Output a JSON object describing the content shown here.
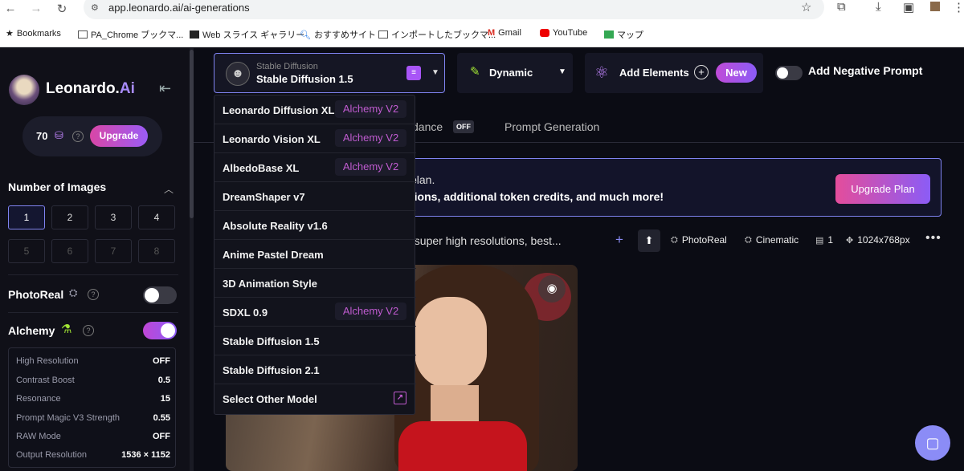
{
  "browser": {
    "url": "app.leonardo.ai/ai-generations",
    "bookmarks": [
      "Bookmarks",
      "PA_Chrome ブックマ...",
      "Web スライス ギャラリー",
      "おすすめサイト",
      "インポートしたブックマ...",
      "Gmail",
      "YouTube",
      "マップ"
    ]
  },
  "sidebar": {
    "brand_main": "Leonardo.",
    "brand_accent": "Ai",
    "tokens": "70",
    "upgrade_label": "Upgrade",
    "num_images_title": "Number of Images",
    "num_buttons": [
      "1",
      "2",
      "3",
      "4",
      "5",
      "6",
      "7",
      "8"
    ],
    "selected_num": "1",
    "photoreal_label": "PhotoReal",
    "photoreal_on": false,
    "alchemy_label": "Alchemy",
    "alchemy_on": true,
    "alchemy_settings": [
      {
        "label": "High Resolution",
        "value": "OFF"
      },
      {
        "label": "Contrast Boost",
        "value": "0.5"
      },
      {
        "label": "Resonance",
        "value": "15"
      },
      {
        "label": "Prompt Magic V3 Strength",
        "value": "0.55"
      },
      {
        "label": "RAW Mode",
        "value": "OFF"
      },
      {
        "label": "Output Resolution",
        "value": "1536 × 1152"
      }
    ]
  },
  "toolbar": {
    "model_small": "Stable Diffusion",
    "model_big": "Stable Diffusion 1.5",
    "style_label": "Dynamic",
    "add_elements_label": "Add Elements",
    "new_badge": "New",
    "negative_prompt_label": "Add Negative Prompt"
  },
  "tabs": {
    "guidance_partial": "dance",
    "guidance_state": "OFF",
    "prompt_generation": "Prompt Generation"
  },
  "banner": {
    "line1": "plan.",
    "line2": "tions, additional token credits, and much more!",
    "button": "Upgrade Plan"
  },
  "generation": {
    "prompt_partial": ", super high resolutions, best...",
    "photoreal_tag": "PhotoReal",
    "cinematic_tag": "Cinematic",
    "image_count": "1",
    "dimensions": "1024x768px"
  },
  "model_dropdown": [
    {
      "name": "Leonardo Diffusion XL",
      "badge": "Alchemy V2"
    },
    {
      "name": "Leonardo Vision XL",
      "badge": "Alchemy V2"
    },
    {
      "name": "AlbedoBase XL",
      "badge": "Alchemy V2"
    },
    {
      "name": "DreamShaper v7",
      "badge": ""
    },
    {
      "name": "Absolute Reality v1.6",
      "badge": ""
    },
    {
      "name": "Anime Pastel Dream",
      "badge": ""
    },
    {
      "name": "3D Animation Style",
      "badge": ""
    },
    {
      "name": "SDXL 0.9",
      "badge": "Alchemy V2"
    },
    {
      "name": "Stable Diffusion 1.5",
      "badge": ""
    },
    {
      "name": "Stable Diffusion 2.1",
      "badge": ""
    },
    {
      "name": "Select Other Model",
      "badge": ""
    }
  ],
  "colors": {
    "accent": "#8b5cf6",
    "pink": "#d946a6",
    "badge_text": "#c05bd0",
    "bg": "#0b0c14"
  }
}
